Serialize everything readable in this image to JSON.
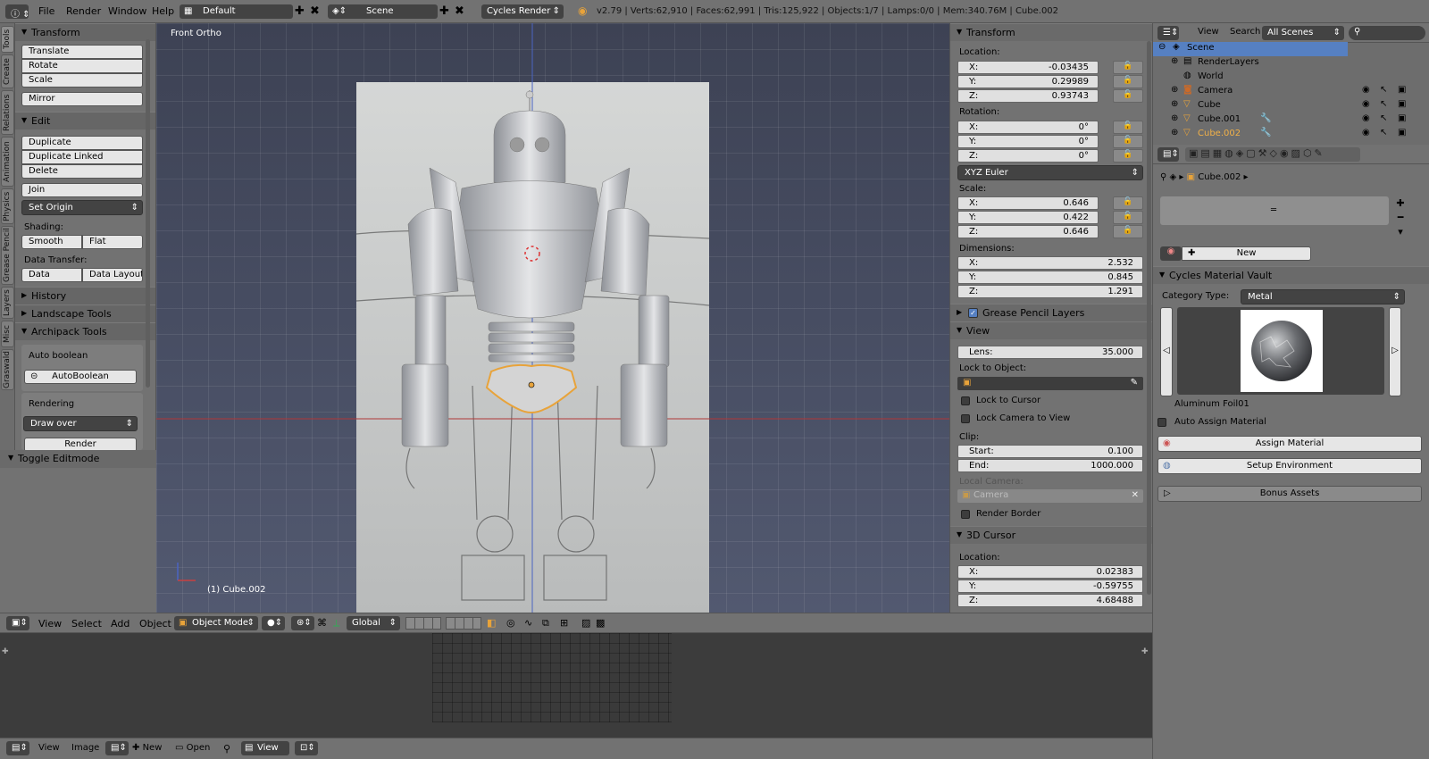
{
  "topbar": {
    "menus": [
      "File",
      "Render",
      "Window",
      "Help"
    ],
    "layout": "Default",
    "scene": "Scene",
    "engine": "Cycles Render",
    "stats": "v2.79 | Verts:62,910 | Faces:62,991 | Tris:125,922 | Objects:1/7 | Lamps:0/0 | Mem:340.76M | Cube.002"
  },
  "tool_tabs": [
    "Tools",
    "Create",
    "Relations",
    "Animation",
    "Physics",
    "Grease Pencil",
    "Layers",
    "Misc",
    "Graswald"
  ],
  "tools": {
    "transform_header": "Transform",
    "translate": "Translate",
    "rotate": "Rotate",
    "scale": "Scale",
    "mirror": "Mirror",
    "edit_header": "Edit",
    "duplicate": "Duplicate",
    "duplicate_linked": "Duplicate Linked",
    "delete": "Delete",
    "join": "Join",
    "set_origin": "Set Origin",
    "shading_label": "Shading:",
    "smooth": "Smooth",
    "flat": "Flat",
    "data_transfer_label": "Data Transfer:",
    "data": "Data",
    "data_layout": "Data Layout",
    "history": "History",
    "landscape_tools": "Landscape Tools",
    "archipack_tools": "Archipack Tools",
    "auto_boolean_label": "Auto boolean",
    "auto_boolean_btn": "AutoBoolean",
    "rendering_label": "Rendering",
    "draw_over": "Draw over",
    "render_btn": "Render",
    "toggle_editmode": "Toggle Editmode"
  },
  "viewport": {
    "view_label": "Front Ortho",
    "object_label": "(1) Cube.002"
  },
  "nprops": {
    "transform_header": "Transform",
    "location_label": "Location:",
    "location": {
      "x": "-0.03435",
      "y": "0.29989",
      "z": "0.93743"
    },
    "rotation_label": "Rotation:",
    "rotation": {
      "x": "0°",
      "y": "0°",
      "z": "0°"
    },
    "rotation_mode": "XYZ Euler",
    "scale_label": "Scale:",
    "scale": {
      "x": "0.646",
      "y": "0.422",
      "z": "0.646"
    },
    "dimensions_label": "Dimensions:",
    "dimensions": {
      "x": "2.532",
      "y": "0.845",
      "z": "1.291"
    },
    "grease_pencil_layers": "Grease Pencil Layers",
    "view_header": "View",
    "lens_label": "Lens:",
    "lens": "35.000",
    "lock_to_object_label": "Lock to Object:",
    "lock_to_cursor": "Lock to Cursor",
    "lock_camera_to_view": "Lock Camera to View",
    "clip_label": "Clip:",
    "clip_start_label": "Start:",
    "clip_start": "0.100",
    "clip_end_label": "End:",
    "clip_end": "1000.000",
    "local_camera_label": "Local Camera:",
    "local_camera": "Camera",
    "render_border": "Render Border",
    "cursor_header": "3D Cursor",
    "cursor_location_label": "Location:",
    "cursor": {
      "x": "0.02383",
      "y": "-0.59755",
      "z": "4.68488"
    },
    "axis_x": "X:",
    "axis_y": "Y:",
    "axis_z": "Z:"
  },
  "outliner": {
    "menus": [
      "View",
      "Search"
    ],
    "filter": "All Scenes",
    "items": [
      "Scene",
      "RenderLayers",
      "World",
      "Camera",
      "Cube",
      "Cube.001",
      "Cube.002"
    ]
  },
  "properties": {
    "object_name": "Cube.002",
    "new_button": "New",
    "vault_header": "Cycles Material Vault",
    "category_label": "Category Type:",
    "category": "Metal",
    "material_name": "Aluminum Foil01",
    "auto_assign": "Auto Assign Material",
    "assign_material": "Assign Material",
    "setup_environment": "Setup Environment",
    "bonus_assets": "Bonus Assets"
  },
  "view_toolbar": {
    "menus": [
      "View",
      "Select",
      "Add",
      "Object"
    ],
    "mode": "Object Mode",
    "orientation": "Global"
  },
  "image_toolbar": {
    "menus": [
      "View",
      "Image"
    ],
    "new": "New",
    "open": "Open",
    "view": "View"
  },
  "colors": {
    "selection": "#5680c2",
    "accent_orange": "#e8a33a",
    "panel_bg": "#727272"
  }
}
